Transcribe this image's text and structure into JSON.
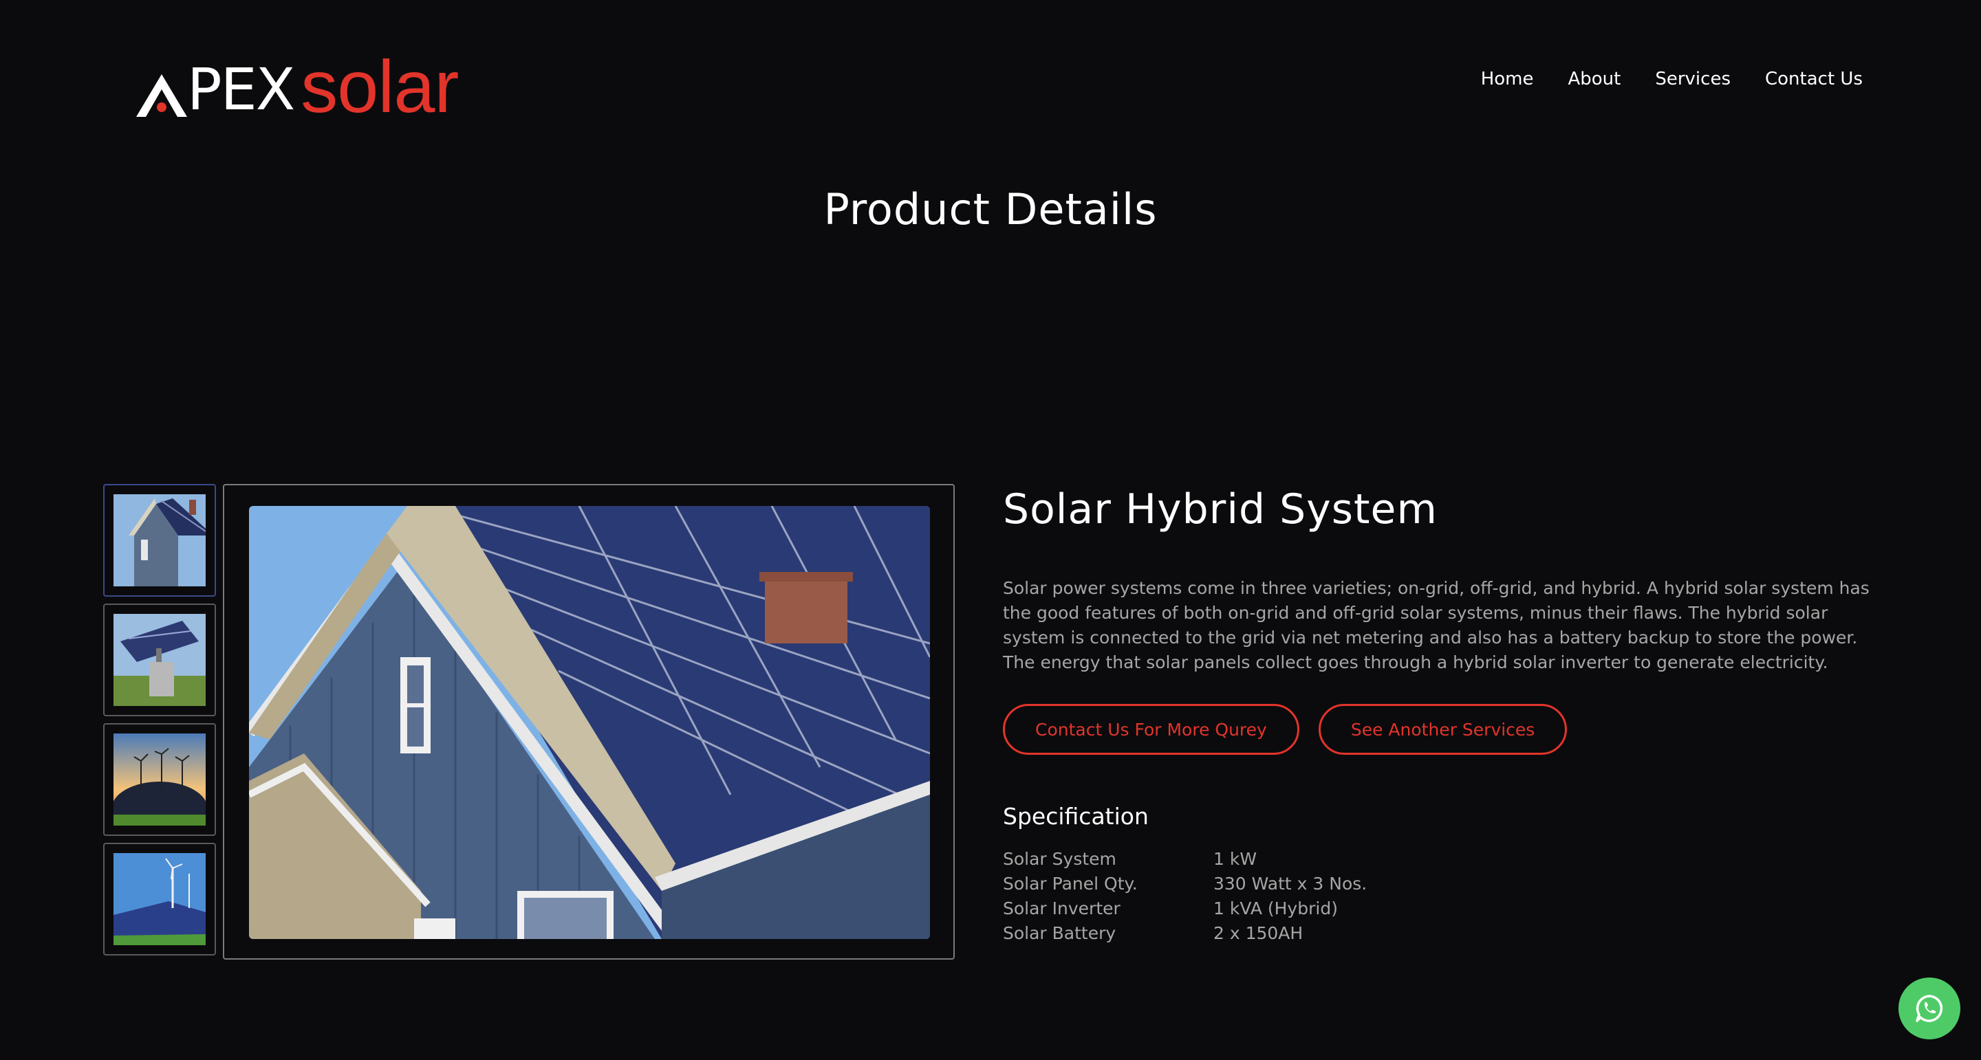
{
  "header": {
    "logo": {
      "part1": "PEX",
      "part2": "solar"
    },
    "nav": [
      "Home",
      "About",
      "Services",
      "Contact Us"
    ]
  },
  "page_title": "Product Details",
  "gallery": {
    "thumbnails": [
      {
        "icon": "house-solar-image",
        "active": true
      },
      {
        "icon": "solar-tracker-image",
        "active": false
      },
      {
        "icon": "wind-solar-sunset-image",
        "active": false
      },
      {
        "icon": "wind-solar-field-image",
        "active": false
      }
    ],
    "main_image": "house-solar-roof-image"
  },
  "product": {
    "title": "Solar Hybrid System",
    "description": "Solar power systems come in three varieties; on-grid, off-grid, and hybrid. A hybrid solar system has the good features of both on-grid and off-grid solar systems, minus their flaws. The hybrid solar system is connected to the grid via net metering and also has a battery backup to store the power. The energy that solar panels collect goes through a hybrid solar inverter to generate electricity.",
    "buttons": {
      "contact": "Contact Us For More Qurey",
      "services": "See Another Services"
    },
    "spec_title": "Specification",
    "specs": [
      {
        "label": "Solar System",
        "value": "1 kW"
      },
      {
        "label": "Solar Panel Qty.",
        "value": "330 Watt x 3 Nos."
      },
      {
        "label": "Solar Inverter",
        "value": "1 kVA (Hybrid)"
      },
      {
        "label": "Solar Battery",
        "value": "2 x 150AH"
      }
    ]
  },
  "colors": {
    "accent": "#e2342b",
    "background": "#0b0b0d",
    "muted_text": "#a6a6a6",
    "whatsapp": "#4ecb67"
  },
  "floating": {
    "icon": "whatsapp-icon"
  }
}
